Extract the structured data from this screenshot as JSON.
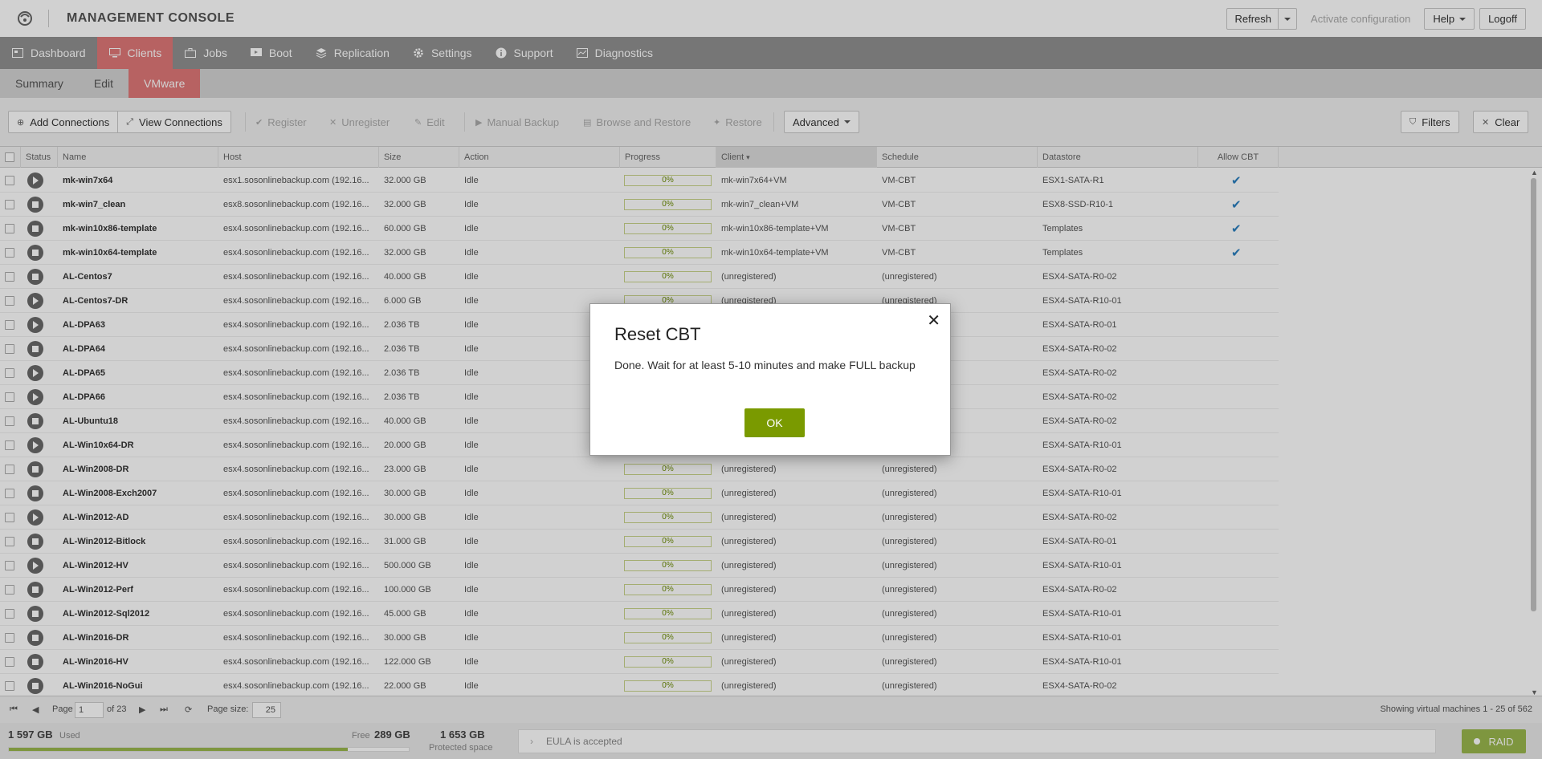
{
  "header": {
    "title": "MANAGEMENT CONSOLE",
    "refresh_label": "Refresh",
    "activate_label": "Activate configuration",
    "help_label": "Help",
    "logoff_label": "Logoff"
  },
  "nav": {
    "items": [
      {
        "label": "Dashboard",
        "icon": "dashboard-icon"
      },
      {
        "label": "Clients",
        "icon": "monitor-icon"
      },
      {
        "label": "Jobs",
        "icon": "briefcase-icon"
      },
      {
        "label": "Boot",
        "icon": "boot-icon"
      },
      {
        "label": "Replication",
        "icon": "replication-icon"
      },
      {
        "label": "Settings",
        "icon": "gear-icon"
      },
      {
        "label": "Support",
        "icon": "info-icon"
      },
      {
        "label": "Diagnostics",
        "icon": "diagnostics-icon"
      }
    ],
    "active": "Clients"
  },
  "subnav": {
    "items": [
      "Summary",
      "Edit",
      "VMware"
    ],
    "active": "VMware"
  },
  "toolbar": {
    "add_connections": "Add Connections",
    "view_connections": "View Connections",
    "register": "Register",
    "unregister": "Unregister",
    "edit": "Edit",
    "manual_backup": "Manual Backup",
    "browse_restore": "Browse and Restore",
    "restore": "Restore",
    "advanced": "Advanced",
    "filters": "Filters",
    "clear": "Clear"
  },
  "table": {
    "columns": [
      "Status",
      "Name",
      "Host",
      "Size",
      "Action",
      "Progress",
      "Client",
      "Schedule",
      "Datastore",
      "Allow CBT"
    ],
    "sorted_column": "Client",
    "rows": [
      {
        "status": "play",
        "name": "mk-win7x64",
        "host": "esx1.sosonlinebackup.com (192.16...",
        "size": "32.000 GB",
        "action": "Idle",
        "progress": "0%",
        "client": "mk-win7x64+VM",
        "schedule": "VM-CBT",
        "datastore": "ESX1-SATA-R1",
        "cbt": true
      },
      {
        "status": "stop",
        "name": "mk-win7_clean",
        "host": "esx8.sosonlinebackup.com (192.16...",
        "size": "32.000 GB",
        "action": "Idle",
        "progress": "0%",
        "client": "mk-win7_clean+VM",
        "schedule": "VM-CBT",
        "datastore": "ESX8-SSD-R10-1",
        "cbt": true
      },
      {
        "status": "stop",
        "name": "mk-win10x86-template",
        "host": "esx4.sosonlinebackup.com (192.16...",
        "size": "60.000 GB",
        "action": "Idle",
        "progress": "0%",
        "client": "mk-win10x86-template+VM",
        "schedule": "VM-CBT",
        "datastore": "Templates",
        "cbt": true
      },
      {
        "status": "stop",
        "name": "mk-win10x64-template",
        "host": "esx4.sosonlinebackup.com (192.16...",
        "size": "32.000 GB",
        "action": "Idle",
        "progress": "0%",
        "client": "mk-win10x64-template+VM",
        "schedule": "VM-CBT",
        "datastore": "Templates",
        "cbt": true
      },
      {
        "status": "stop",
        "name": "AL-Centos7",
        "host": "esx4.sosonlinebackup.com (192.16...",
        "size": "40.000 GB",
        "action": "Idle",
        "progress": "0%",
        "client": "(unregistered)",
        "schedule": "(unregistered)",
        "datastore": "ESX4-SATA-R0-02",
        "cbt": false
      },
      {
        "status": "play",
        "name": "AL-Centos7-DR",
        "host": "esx4.sosonlinebackup.com (192.16...",
        "size": "6.000 GB",
        "action": "Idle",
        "progress": "0%",
        "client": "(unregistered)",
        "schedule": "(unregistered)",
        "datastore": "ESX4-SATA-R10-01",
        "cbt": false
      },
      {
        "status": "play",
        "name": "AL-DPA63",
        "host": "esx4.sosonlinebackup.com (192.16...",
        "size": "2.036 TB",
        "action": "Idle",
        "progress": "",
        "client": "",
        "schedule": "",
        "datastore": "ESX4-SATA-R0-01",
        "cbt": false
      },
      {
        "status": "stop",
        "name": "AL-DPA64",
        "host": "esx4.sosonlinebackup.com (192.16...",
        "size": "2.036 TB",
        "action": "Idle",
        "progress": "",
        "client": "",
        "schedule": "",
        "datastore": "ESX4-SATA-R0-02",
        "cbt": false
      },
      {
        "status": "play",
        "name": "AL-DPA65",
        "host": "esx4.sosonlinebackup.com (192.16...",
        "size": "2.036 TB",
        "action": "Idle",
        "progress": "",
        "client": "",
        "schedule": "",
        "datastore": "ESX4-SATA-R0-02",
        "cbt": false
      },
      {
        "status": "play",
        "name": "AL-DPA66",
        "host": "esx4.sosonlinebackup.com (192.16...",
        "size": "2.036 TB",
        "action": "Idle",
        "progress": "",
        "client": "",
        "schedule": "",
        "datastore": "ESX4-SATA-R0-02",
        "cbt": false
      },
      {
        "status": "stop",
        "name": "AL-Ubuntu18",
        "host": "esx4.sosonlinebackup.com (192.16...",
        "size": "40.000 GB",
        "action": "Idle",
        "progress": "",
        "client": "",
        "schedule": "",
        "datastore": "ESX4-SATA-R0-02",
        "cbt": false
      },
      {
        "status": "play",
        "name": "AL-Win10x64-DR",
        "host": "esx4.sosonlinebackup.com (192.16...",
        "size": "20.000 GB",
        "action": "Idle",
        "progress": "",
        "client": "",
        "schedule": "",
        "datastore": "ESX4-SATA-R10-01",
        "cbt": false
      },
      {
        "status": "stop",
        "name": "AL-Win2008-DR",
        "host": "esx4.sosonlinebackup.com (192.16...",
        "size": "23.000 GB",
        "action": "Idle",
        "progress": "0%",
        "client": "(unregistered)",
        "schedule": "(unregistered)",
        "datastore": "ESX4-SATA-R0-02",
        "cbt": false
      },
      {
        "status": "stop",
        "name": "AL-Win2008-Exch2007",
        "host": "esx4.sosonlinebackup.com (192.16...",
        "size": "30.000 GB",
        "action": "Idle",
        "progress": "0%",
        "client": "(unregistered)",
        "schedule": "(unregistered)",
        "datastore": "ESX4-SATA-R10-01",
        "cbt": false
      },
      {
        "status": "play",
        "name": "AL-Win2012-AD",
        "host": "esx4.sosonlinebackup.com (192.16...",
        "size": "30.000 GB",
        "action": "Idle",
        "progress": "0%",
        "client": "(unregistered)",
        "schedule": "(unregistered)",
        "datastore": "ESX4-SATA-R0-02",
        "cbt": false
      },
      {
        "status": "stop",
        "name": "AL-Win2012-Bitlock",
        "host": "esx4.sosonlinebackup.com (192.16...",
        "size": "31.000 GB",
        "action": "Idle",
        "progress": "0%",
        "client": "(unregistered)",
        "schedule": "(unregistered)",
        "datastore": "ESX4-SATA-R0-01",
        "cbt": false
      },
      {
        "status": "play",
        "name": "AL-Win2012-HV",
        "host": "esx4.sosonlinebackup.com (192.16...",
        "size": "500.000 GB",
        "action": "Idle",
        "progress": "0%",
        "client": "(unregistered)",
        "schedule": "(unregistered)",
        "datastore": "ESX4-SATA-R10-01",
        "cbt": false
      },
      {
        "status": "stop",
        "name": "AL-Win2012-Perf",
        "host": "esx4.sosonlinebackup.com (192.16...",
        "size": "100.000 GB",
        "action": "Idle",
        "progress": "0%",
        "client": "(unregistered)",
        "schedule": "(unregistered)",
        "datastore": "ESX4-SATA-R0-02",
        "cbt": false
      },
      {
        "status": "stop",
        "name": "AL-Win2012-Sql2012",
        "host": "esx4.sosonlinebackup.com (192.16...",
        "size": "45.000 GB",
        "action": "Idle",
        "progress": "0%",
        "client": "(unregistered)",
        "schedule": "(unregistered)",
        "datastore": "ESX4-SATA-R10-01",
        "cbt": false
      },
      {
        "status": "stop",
        "name": "AL-Win2016-DR",
        "host": "esx4.sosonlinebackup.com (192.16...",
        "size": "30.000 GB",
        "action": "Idle",
        "progress": "0%",
        "client": "(unregistered)",
        "schedule": "(unregistered)",
        "datastore": "ESX4-SATA-R10-01",
        "cbt": false
      },
      {
        "status": "stop",
        "name": "AL-Win2016-HV",
        "host": "esx4.sosonlinebackup.com (192.16...",
        "size": "122.000 GB",
        "action": "Idle",
        "progress": "0%",
        "client": "(unregistered)",
        "schedule": "(unregistered)",
        "datastore": "ESX4-SATA-R10-01",
        "cbt": false
      },
      {
        "status": "stop",
        "name": "AL-Win2016-NoGui",
        "host": "esx4.sosonlinebackup.com (192.16...",
        "size": "22.000 GB",
        "action": "Idle",
        "progress": "0%",
        "client": "(unregistered)",
        "schedule": "(unregistered)",
        "datastore": "ESX4-SATA-R0-02",
        "cbt": false
      }
    ]
  },
  "pager": {
    "page_label": "Page",
    "page": "1",
    "of_label": "of 23",
    "page_size_label": "Page size:",
    "page_size": "25",
    "showing": "Showing virtual machines 1 - 25 of 562"
  },
  "footer": {
    "used": "1 597 GB",
    "used_label": "Used",
    "free_label": "Free",
    "free": "289 GB",
    "used_fraction": 0.847,
    "protected": "1 653 GB",
    "protected_label": "Protected space",
    "eula": "EULA is accepted",
    "raid": "RAID"
  },
  "dialog": {
    "title": "Reset CBT",
    "message": "Done. Wait for at least 5-10 minutes and make FULL backup",
    "ok_label": "OK"
  },
  "colors": {
    "accent": "#e07878",
    "nav_bg": "#909090",
    "ok_button": "#7a9a00",
    "check": "#2b7fbf"
  }
}
